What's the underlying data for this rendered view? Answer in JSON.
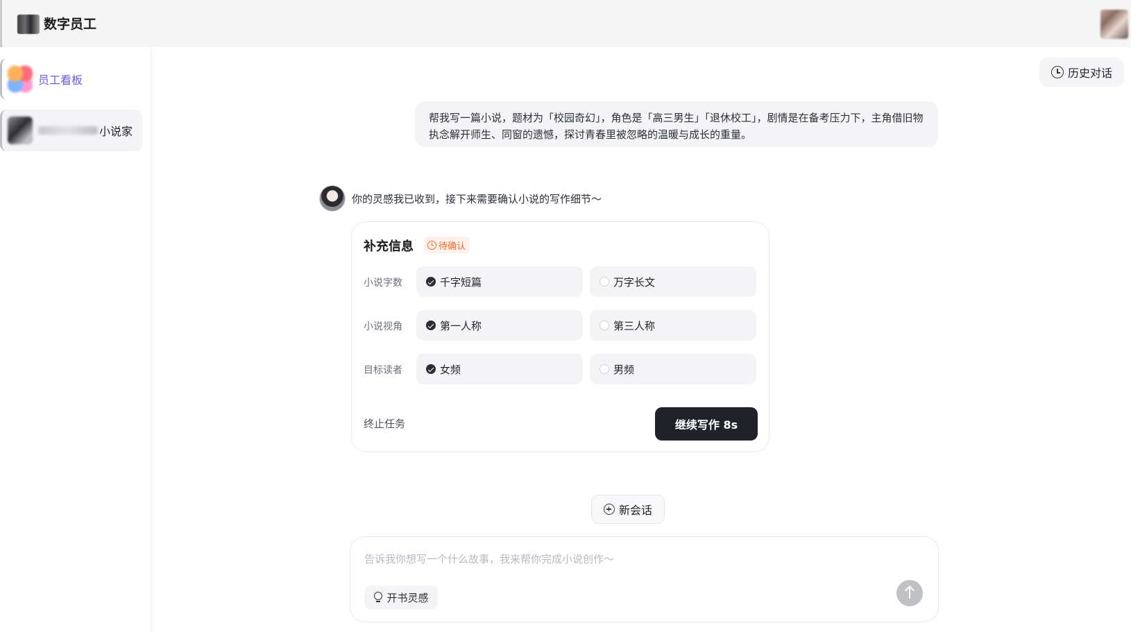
{
  "header": {
    "brand": "数字员工",
    "logo_icon": "app-logo-icon",
    "avatar_icon": "user-avatar"
  },
  "sidebar": {
    "items": [
      {
        "label": "员工看板",
        "icon": "employee-board-icon",
        "active": true
      },
      {
        "label": "小说家",
        "icon": "novelist-avatar-icon",
        "active": false
      }
    ]
  },
  "toolbar": {
    "history_label": "历史对话"
  },
  "conversation": {
    "user_message": "帮我写一篇小说，题材为「校园奇幻」，角色是「高三男生」「退休校工」，剧情是在备考压力下，主角借旧物执念解开师生、同窗的遗憾，探讨青春里被忽略的温暖与成长的重量。",
    "bot_message": "你的灵感我已收到，接下来需要确认小说的写作细节～"
  },
  "card": {
    "title": "补充信息",
    "badge": "待确认",
    "rows": [
      {
        "label": "小说字数",
        "options": [
          {
            "label": "千字短篇",
            "checked": true
          },
          {
            "label": "万字长文",
            "checked": false
          }
        ]
      },
      {
        "label": "小说视角",
        "options": [
          {
            "label": "第一人称",
            "checked": true
          },
          {
            "label": "第三人称",
            "checked": false
          }
        ]
      },
      {
        "label": "目标读者",
        "options": [
          {
            "label": "女频",
            "checked": true
          },
          {
            "label": "男频",
            "checked": false
          }
        ]
      }
    ],
    "stop_label": "终止任务",
    "continue_label": "继续写作 8s"
  },
  "new_session_label": "新会话",
  "composer": {
    "placeholder": "告诉我你想写一个什么故事，我来帮你完成小说创作～",
    "value": "",
    "inspiration_label": "开书灵感"
  },
  "colors": {
    "accent": "#6b59e8",
    "badge": "#f26a2e",
    "primary_button": "#1f2329"
  }
}
